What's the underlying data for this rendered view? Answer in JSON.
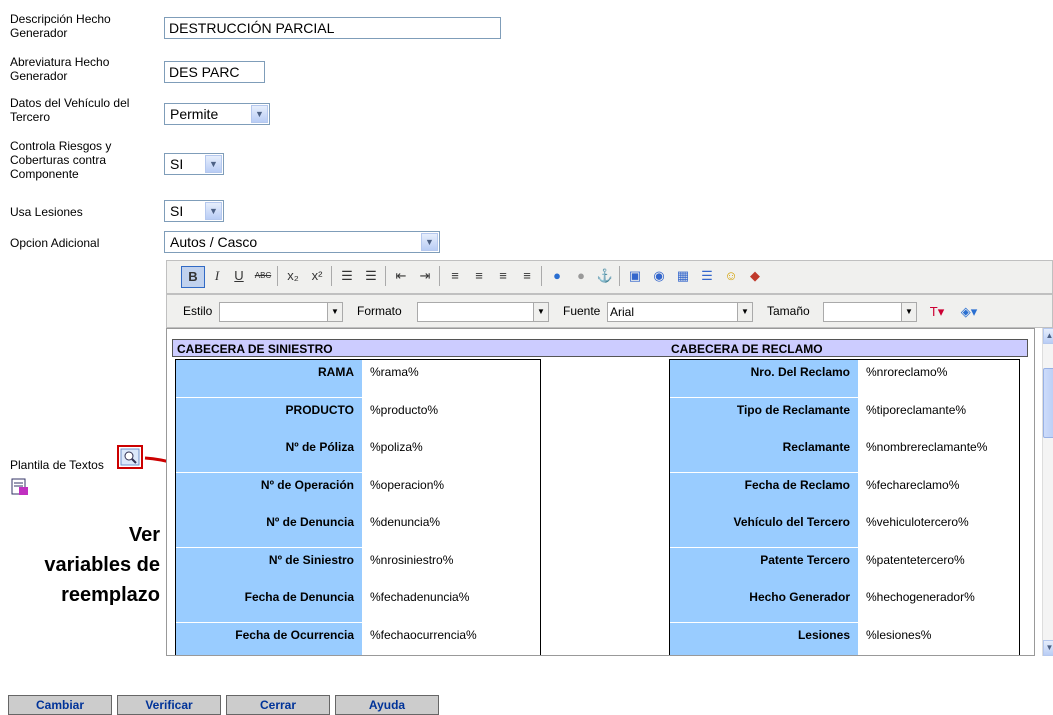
{
  "form": {
    "descripcion_label": "Descripción Hecho Generador",
    "descripcion_value": "DESTRUCCIÓN PARCIAL",
    "abreviatura_label": "Abreviatura Hecho Generador",
    "abreviatura_value": "DES PARC",
    "datos_vehiculo_label": "Datos del Vehículo del Tercero",
    "datos_vehiculo_value": "Permite",
    "controla_label": "Controla Riesgos y Coberturas contra Componente",
    "controla_value": "SI",
    "lesiones_label": "Usa Lesiones",
    "lesiones_value": "SI",
    "opcion_label": "Opcion Adicional",
    "opcion_value": "Autos / Casco",
    "plantilla_label": "Plantila de Textos"
  },
  "editor": {
    "estilo_label": "Estilo",
    "formato_label": "Formato",
    "fuente_label": "Fuente",
    "fuente_value": "Arial",
    "tamano_label": "Tamaño",
    "header_left": "CABECERA DE SINIESTRO",
    "header_right": "CABECERA DE RECLAMO",
    "left_rows": [
      {
        "label": "RAMA",
        "value": "%rama%"
      },
      {
        "label": "PRODUCTO",
        "value": "%producto%"
      },
      {
        "label": "Nº de Póliza",
        "value": "%poliza%"
      },
      {
        "label": "Nº de Operación",
        "value": "%operacion%"
      },
      {
        "label": "Nº de Denuncia",
        "value": "%denuncia%"
      },
      {
        "label": "Nº de Siniestro",
        "value": "%nrosiniestro%"
      },
      {
        "label": "Fecha de Denuncia",
        "value": "%fechadenuncia%"
      },
      {
        "label": "Fecha de Ocurrencia",
        "value": "%fechaocurrencia%"
      }
    ],
    "right_rows": [
      {
        "label": "Nro. Del Reclamo",
        "value": "%nroreclamo%"
      },
      {
        "label": "Tipo de Reclamante",
        "value": "%tiporeclamante%"
      },
      {
        "label": "Reclamante",
        "value": "%nombrereclamante%"
      },
      {
        "label": "Fecha de Reclamo",
        "value": "%fechareclamo%"
      },
      {
        "label": "Vehículo del Tercero",
        "value": "%vehiculotercero%"
      },
      {
        "label": "Patente Tercero",
        "value": "%patentetercero%"
      },
      {
        "label": "Hecho Generador",
        "value": "%hechogenerador%"
      },
      {
        "label": "Lesiones",
        "value": "%lesiones%"
      }
    ]
  },
  "callout": {
    "line1": "Ver",
    "line2": "variables de",
    "line3": "reemplazo",
    "color": "#cc0000"
  },
  "buttons": {
    "cambiar": "Cambiar",
    "verificar": "Verificar",
    "cerrar": "Cerrar",
    "ayuda": "Ayuda"
  }
}
